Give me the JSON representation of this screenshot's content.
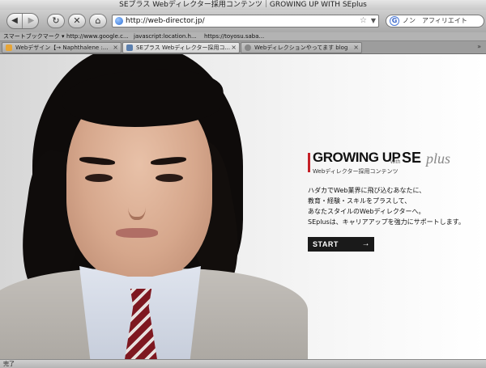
{
  "window": {
    "title": "SEプラス Webディレクター採用コンテンツ｜GROWING UP WITH SEplus"
  },
  "toolbar": {
    "back_icon": "back-arrow-icon",
    "forward_icon": "forward-arrow-icon",
    "url": "http://web-director.jp/",
    "search_value": "ノン　アフィリエイト"
  },
  "bookmarks": {
    "items": [
      "スマートブックマーク ▾",
      "http://www.google.c...",
      "javascript:location.h...",
      "https://toyosu.saba..."
    ]
  },
  "tabs": [
    {
      "label": "Webデザイン【→ Naphthalene :..."
    },
    {
      "label": "SEプラス Webディレクター採用コ..."
    },
    {
      "label": "Webディレクションやってます blog"
    }
  ],
  "hero": {
    "logo_main": "GROWING UP",
    "logo_with": "with",
    "logo_se": "SE",
    "logo_plus": "plus",
    "logo_sub": "Webディレクター採用コンテンツ",
    "lines": [
      "ハダカでWeb業界に飛び込むあなたに、",
      "教育・経験・スキルをプラスして、",
      "あなたスタイルのWebディレクターへ。",
      "SEplusは、キャリアアップを強力にサポートします。"
    ],
    "start_label": "START"
  },
  "status": {
    "text": "完了"
  },
  "colors": {
    "accent_red": "#c52027",
    "start_bg": "#1a1a1a"
  }
}
